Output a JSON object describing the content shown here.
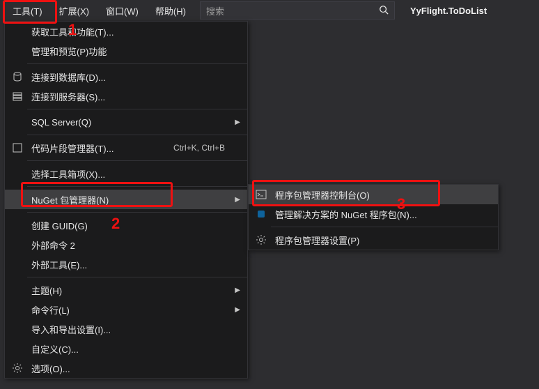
{
  "menubar": {
    "tools": "工具(T)",
    "extensions": "扩展(X)",
    "window": "窗口(W)",
    "help": "帮助(H)"
  },
  "search": {
    "placeholder": "搜索"
  },
  "project_name": "YyFlight.ToDoList",
  "tools_menu": {
    "get_tools": "获取工具和功能(T)...",
    "manage_preview": "管理和预览(P)功能",
    "connect_db": "连接到数据库(D)...",
    "connect_server": "连接到服务器(S)...",
    "sql_server": "SQL Server(Q)",
    "code_snippet": "代码片段管理器(T)...",
    "code_snippet_shortcut": "Ctrl+K, Ctrl+B",
    "toolbox": "选择工具箱项(X)...",
    "nuget": "NuGet 包管理器(N)",
    "create_guid": "创建 GUID(G)",
    "ext_cmd2": "外部命令 2",
    "ext_tools": "外部工具(E)...",
    "theme": "主题(H)",
    "cmdline": "命令行(L)",
    "import_export": "导入和导出设置(I)...",
    "customize": "自定义(C)...",
    "options": "选项(O)..."
  },
  "nuget_submenu": {
    "console": "程序包管理器控制台(O)",
    "manage": "管理解决方案的 NuGet 程序包(N)...",
    "settings": "程序包管理器设置(P)"
  },
  "annotations": {
    "n1": "1",
    "n2": "2",
    "n3": "3"
  }
}
